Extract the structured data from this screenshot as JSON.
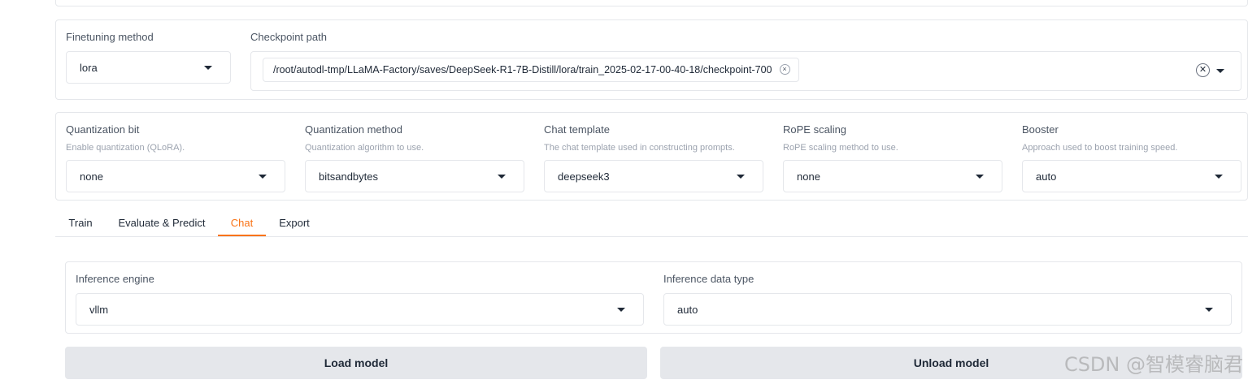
{
  "top_config": {
    "finetuning_method": {
      "label": "Finetuning method",
      "value": "lora"
    },
    "checkpoint_path": {
      "label": "Checkpoint path",
      "selected": "/root/autodl-tmp/LLaMA-Factory/saves/DeepSeek-R1-7B-Distill/lora/train_2025-02-17-00-40-18/checkpoint-700",
      "chip_remove_glyph": "×",
      "clear_glyph": "✕"
    }
  },
  "advanced": {
    "quantization_bit": {
      "label": "Quantization bit",
      "info": "Enable quantization (QLoRA).",
      "value": "none"
    },
    "quantization_method": {
      "label": "Quantization method",
      "info": "Quantization algorithm to use.",
      "value": "bitsandbytes"
    },
    "chat_template": {
      "label": "Chat template",
      "info": "The chat template used in constructing prompts.",
      "value": "deepseek3"
    },
    "rope_scaling": {
      "label": "RoPE scaling",
      "info": "RoPE scaling method to use.",
      "value": "none"
    },
    "booster": {
      "label": "Booster",
      "info": "Approach used to boost training speed.",
      "value": "auto"
    }
  },
  "tabs": [
    {
      "label": "Train",
      "active": false
    },
    {
      "label": "Evaluate & Predict",
      "active": false
    },
    {
      "label": "Chat",
      "active": true
    },
    {
      "label": "Export",
      "active": false
    }
  ],
  "chat": {
    "inference_engine": {
      "label": "Inference engine",
      "value": "vllm"
    },
    "inference_dtype": {
      "label": "Inference data type",
      "value": "auto"
    },
    "load_label": "Load model",
    "unload_label": "Unload model"
  },
  "watermark": "CSDN @智模睿脑君",
  "colors": {
    "accent": "#f97316",
    "border": "#e5e7eb",
    "button_bg": "#e5e7eb"
  }
}
